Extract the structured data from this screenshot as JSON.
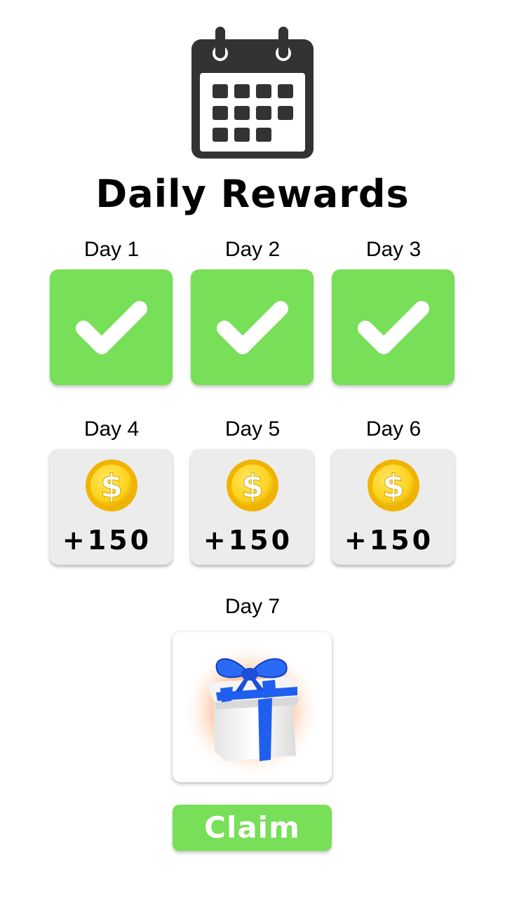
{
  "header": {
    "icon": "calendar-icon",
    "title": "Daily Rewards"
  },
  "days": [
    {
      "label": "Day 1",
      "status": "claimed",
      "icon": "checkmark-icon"
    },
    {
      "label": "Day 2",
      "status": "claimed",
      "icon": "checkmark-icon"
    },
    {
      "label": "Day 3",
      "status": "claimed",
      "icon": "checkmark-icon"
    },
    {
      "label": "Day 4",
      "status": "reward",
      "icon": "dollar-coin-icon",
      "amount": "+150"
    },
    {
      "label": "Day 5",
      "status": "reward",
      "icon": "dollar-coin-icon",
      "amount": "+150"
    },
    {
      "label": "Day 6",
      "status": "reward",
      "icon": "dollar-coin-icon",
      "amount": "+150"
    },
    {
      "label": "Day 7",
      "status": "reward",
      "icon": "gift-box-icon"
    }
  ],
  "claim_button": {
    "label": "Claim"
  },
  "colors": {
    "accent_green": "#77df58",
    "tile_grey": "#ececec",
    "coin_gold": "#fcd21c",
    "ribbon_blue": "#1f5ff0",
    "icon_dark": "#333333"
  }
}
